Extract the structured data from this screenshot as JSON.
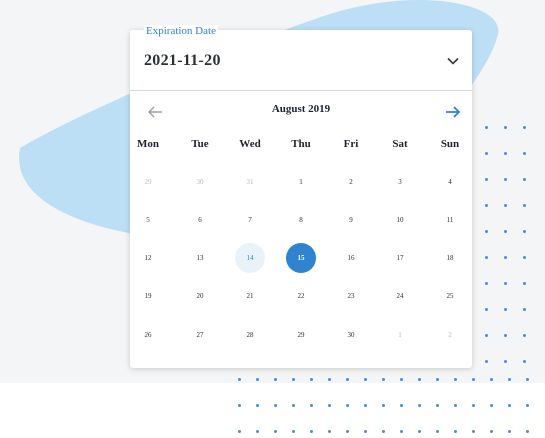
{
  "colors": {
    "accent": "#2f83cf",
    "blob": "#bddff5",
    "dots": "#4a8fd6"
  },
  "date_field": {
    "label": "Expiration Date",
    "value": "2021-11-20",
    "toggle_icon": "chevron-down-icon"
  },
  "calendar": {
    "month_title": "August 2019",
    "prev_icon": "arrow-left-icon",
    "next_icon": "arrow-right-icon",
    "weekdays": [
      "Mon",
      "Tue",
      "Wed",
      "Thu",
      "Fri",
      "Sat",
      "Sun"
    ],
    "weeks": [
      [
        "29",
        "30",
        "31",
        "1",
        "2",
        "3",
        "4"
      ],
      [
        "5",
        "6",
        "7",
        "8",
        "9",
        "10",
        "11"
      ],
      [
        "12",
        "13",
        "14",
        "15",
        "16",
        "17",
        "18"
      ],
      [
        "19",
        "20",
        "21",
        "22",
        "23",
        "24",
        "25"
      ],
      [
        "26",
        "27",
        "28",
        "29",
        "30",
        "1",
        "2"
      ]
    ],
    "hovered_day": "14",
    "selected_day": "15"
  }
}
